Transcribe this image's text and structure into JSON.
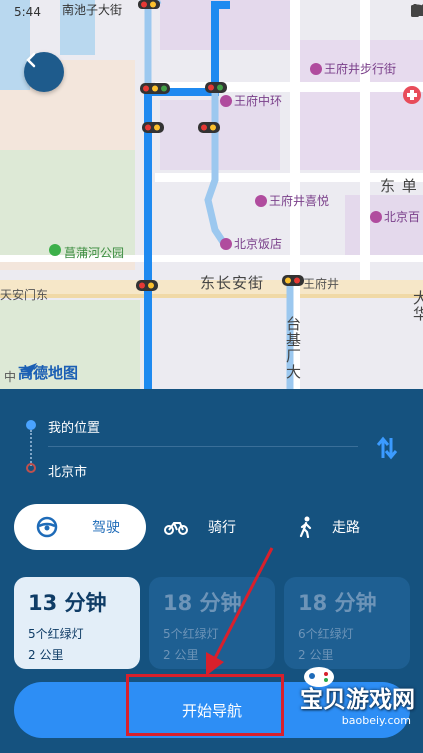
{
  "status": {
    "time": "5:44"
  },
  "map": {
    "labels": {
      "nanchizi": "南池子大街",
      "wangfujing_walk": "王府井步行街",
      "wangfujing_center": "王府中环",
      "dongdan": "东 单 王",
      "xiyue": "王府井喜悦",
      "beijing_dept": "北京百",
      "beijing_hotel": "北京饭店",
      "changpu": "菖蒲河公园",
      "tiananmen": "天安门东",
      "dongchangan": "东长安街",
      "wangfujing_stop": "王府井",
      "taiji": "台基厂大",
      "dahua": "大华",
      "zhong": "中"
    },
    "logo_text": "高德地图",
    "route_color": "#1f8af0"
  },
  "route": {
    "origin": "我的位置",
    "destination": "北京市"
  },
  "modes": [
    {
      "label": "驾驶",
      "icon": "steering-wheel-icon",
      "active": true
    },
    {
      "label": "骑行",
      "icon": "bicycle-icon",
      "active": false
    },
    {
      "label": "走路",
      "icon": "walking-icon",
      "active": false
    }
  ],
  "options": [
    {
      "time": "13 分钟",
      "lights": "5个红绿灯",
      "distance": "2 公里",
      "active": true
    },
    {
      "time": "18 分钟",
      "lights": "5个红绿灯",
      "distance": "2 公里",
      "active": false
    },
    {
      "time": "18 分钟",
      "lights": "6个红绿灯",
      "distance": "2 公里",
      "active": false
    }
  ],
  "start_button": "开始导航",
  "watermark": {
    "title": "宝贝游戏网",
    "url": "baobeiy.com"
  },
  "colors": {
    "panel": "#15527f",
    "accent": "#2d8ef5",
    "annotation": "#d8202c"
  }
}
